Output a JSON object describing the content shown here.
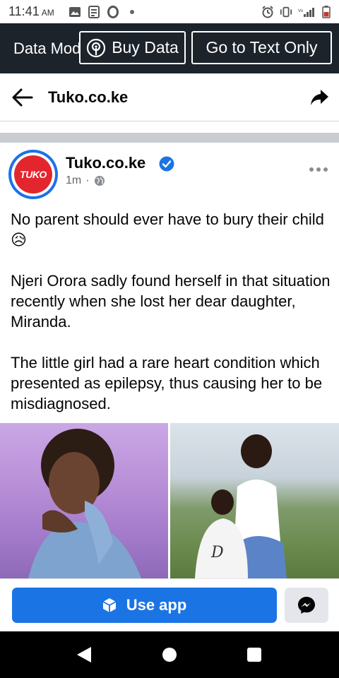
{
  "status_bar": {
    "time": "11:41",
    "ampm": "AM",
    "left_icons": [
      "image-icon",
      "notes-icon",
      "opera-icon",
      "dot-icon"
    ],
    "right_icons": [
      "alarm-icon",
      "vibrate-icon",
      "signal-icon",
      "battery-icon"
    ]
  },
  "data_bar": {
    "mode_label": "Data Mode",
    "buy_data_label": "Buy Data",
    "text_only_label": "Go to Text Only"
  },
  "header": {
    "title": "Tuko.co.ke"
  },
  "post": {
    "avatar_text": "TUKO",
    "author": "Tuko.co.ke",
    "time": "1m",
    "separator": "·",
    "paragraphs": [
      "No parent should ever have to bury their child 😥",
      "Njeri Orora sadly found herself in that situation recently when she lost her dear daughter, Miranda.",
      "The little girl had a rare heart condition which presented as epilepsy, thus causing her to be misdiagnosed."
    ]
  },
  "app_bar": {
    "use_app_label": "Use app"
  },
  "colors": {
    "facebook_blue": "#1b74e4",
    "data_bar_bg": "#1c232b",
    "tuko_red": "#e3262d"
  }
}
